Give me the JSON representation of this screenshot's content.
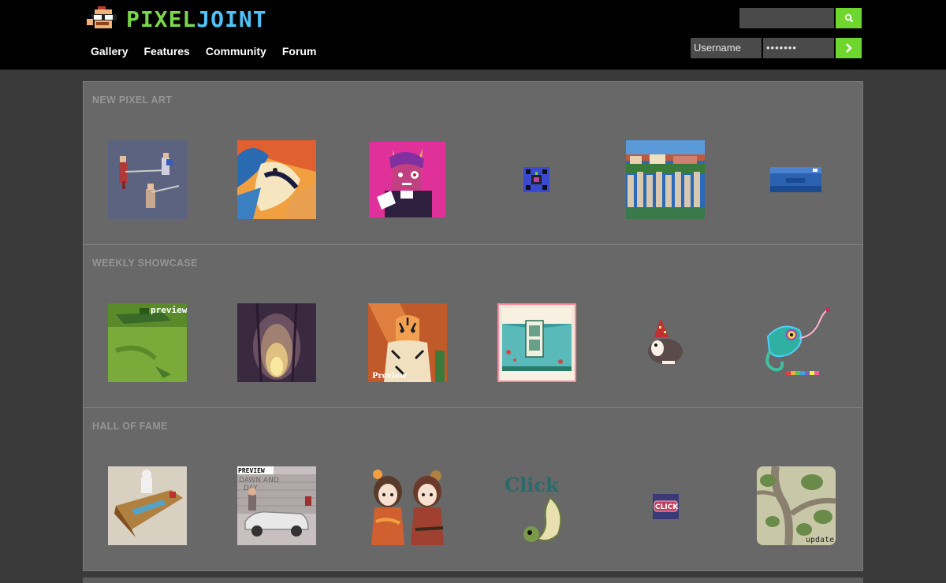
{
  "header": {
    "logo_text_part1": "PIXEL",
    "logo_text_part2": "JOINT",
    "nav": [
      "Gallery",
      "Features",
      "Community",
      "Forum"
    ],
    "search": {
      "value": "",
      "button_icon": "search-icon"
    },
    "login": {
      "username_placeholder": "Username",
      "password_value": "•••••••",
      "button_icon": "chevron-right-icon"
    }
  },
  "sections": [
    {
      "title": "NEW PIXEL ART"
    },
    {
      "title": "WEEKLY SHOWCASE"
    },
    {
      "title": "HALL OF FAME"
    }
  ],
  "thumb_text": {
    "preview_1": "preview",
    "preview_2": "Preview",
    "preview_3": "PREVIEW",
    "click_1": "Click",
    "click_2": "CLICK",
    "update": "update",
    "sign_line1": "DAWN AND",
    "sign_line2": "DAY"
  },
  "colors": {
    "accent": "#6fd62e",
    "header_bg": "#000000",
    "panel_bg": "#686868"
  }
}
